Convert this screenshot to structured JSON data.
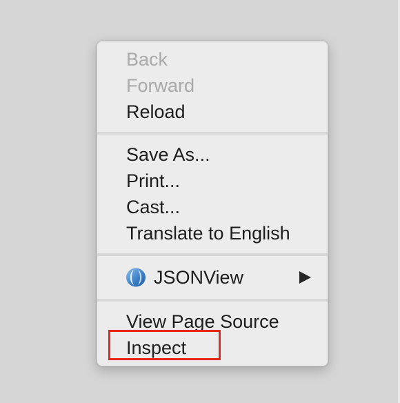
{
  "menu": {
    "groups": [
      {
        "items": [
          {
            "label": "Back",
            "enabled": false
          },
          {
            "label": "Forward",
            "enabled": false
          },
          {
            "label": "Reload",
            "enabled": true
          }
        ]
      },
      {
        "items": [
          {
            "label": "Save As...",
            "enabled": true
          },
          {
            "label": "Print...",
            "enabled": true
          },
          {
            "label": "Cast...",
            "enabled": true
          },
          {
            "label": "Translate to English",
            "enabled": true
          }
        ]
      },
      {
        "items": [
          {
            "label": "JSONView",
            "icon": "jsonview-extension-icon",
            "has_submenu": true
          }
        ]
      },
      {
        "items": [
          {
            "label": "View Page Source",
            "enabled": true
          },
          {
            "label": "Inspect",
            "enabled": true,
            "highlighted": true
          }
        ]
      }
    ]
  },
  "colors": {
    "highlight_border": "#e5271e",
    "disabled_text": "#a9a9a9",
    "menu_background": "#ececec",
    "page_background": "#d6d6d6"
  }
}
